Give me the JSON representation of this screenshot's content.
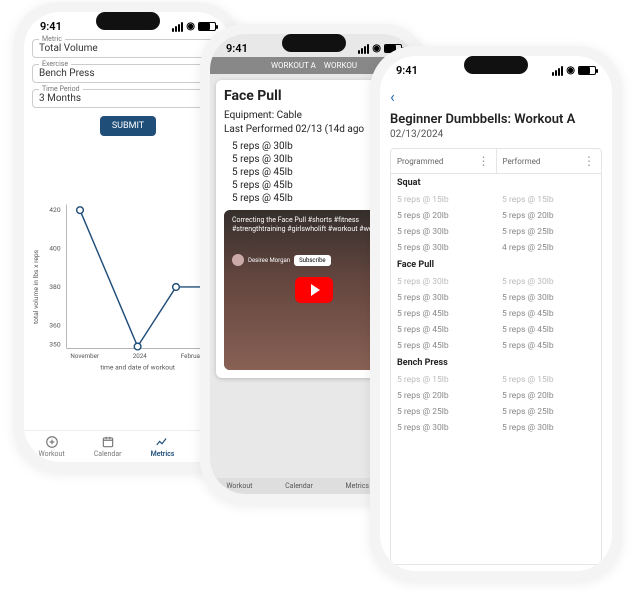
{
  "statusbar": {
    "time": "9:41"
  },
  "phone1": {
    "fields": {
      "metric_label": "Metric",
      "metric_value": "Total Volume",
      "exercise_label": "Exercise",
      "exercise_value": "Bench Press",
      "period_label": "Time Period",
      "period_value": "3 Months"
    },
    "submit_label": "SUBMIT",
    "chart_data": {
      "type": "line",
      "title": "",
      "xlabel": "time and date of workout",
      "ylabel": "total volume in lbs x reps",
      "categories": [
        "November",
        "2024",
        "February"
      ],
      "values": [
        420,
        350,
        380,
        380
      ],
      "ylim": [
        350,
        420
      ],
      "yticks": [
        360,
        380,
        400,
        420
      ]
    },
    "nav": [
      "Workout",
      "Calendar",
      "Metrics",
      ""
    ]
  },
  "phone2": {
    "topTabs": [
      "WORKOUT A",
      "WORKOU"
    ],
    "exercise_name": "Face Pull",
    "equipment_line": "Equipment: Cable",
    "last_performed": "Last Performed 02/13 (14d ago",
    "sets": [
      "5 reps @ 30lb",
      "5 reps @ 30lb",
      "5 reps @ 45lb",
      "5 reps @ 45lb",
      "5 reps @ 45lb"
    ],
    "video": {
      "caption": "Correcting the Face Pull #shorts #fitness #strengthtraining #girlswholift #workout #weightli",
      "author": "Desiree Morgan",
      "subscribe": "Subscribe"
    },
    "nav": [
      "Workout",
      "Calendar",
      "Metrics",
      ""
    ]
  },
  "phone3": {
    "title": "Beginner Dumbbells: Workout A",
    "date": "02/13/2024",
    "columns": {
      "programmed": "Programmed",
      "performed": "Performed"
    },
    "exercises": [
      {
        "name": "Squat",
        "rows": [
          {
            "p": "5 reps @ 15lb",
            "d": "5 reps @ 15lb",
            "dim": true
          },
          {
            "p": "5 reps @ 20lb",
            "d": "5 reps @ 20lb",
            "dim": false
          },
          {
            "p": "5 reps @ 30lb",
            "d": "5 reps @ 25lb",
            "dim": false
          },
          {
            "p": "5 reps @ 30lb",
            "d": "4 reps @ 25lb",
            "dim": false
          }
        ]
      },
      {
        "name": "Face Pull",
        "rows": [
          {
            "p": "5 reps @ 30lb",
            "d": "5 reps @ 30lb",
            "dim": true
          },
          {
            "p": "5 reps @ 30lb",
            "d": "5 reps @ 30lb",
            "dim": false
          },
          {
            "p": "5 reps @ 45lb",
            "d": "5 reps @ 45lb",
            "dim": false
          },
          {
            "p": "5 reps @ 45lb",
            "d": "5 reps @ 45lb",
            "dim": false
          },
          {
            "p": "5 reps @ 45lb",
            "d": "5 reps @ 45lb",
            "dim": false
          }
        ]
      },
      {
        "name": "Bench Press",
        "rows": [
          {
            "p": "5 reps @ 15lb",
            "d": "5 reps @ 15lb",
            "dim": true
          },
          {
            "p": "5 reps @ 20lb",
            "d": "5 reps @ 20lb",
            "dim": false
          },
          {
            "p": "5 reps @ 25lb",
            "d": "5 reps @ 25lb",
            "dim": false
          },
          {
            "p": "5 reps @ 30lb",
            "d": "5 reps @ 30lb",
            "dim": false
          }
        ]
      }
    ]
  }
}
